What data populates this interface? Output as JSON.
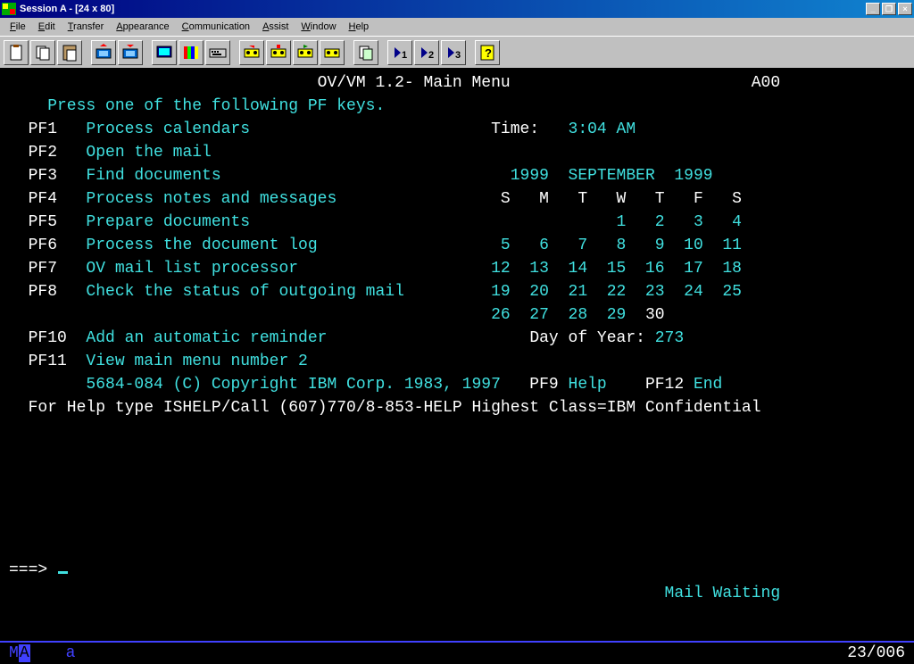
{
  "window": {
    "title": "Session A - [24 x 80]",
    "buttons": {
      "min": "_",
      "max": "❐",
      "close": "×"
    }
  },
  "menu": [
    "File",
    "Edit",
    "Transfer",
    "Appearance",
    "Communication",
    "Assist",
    "Window",
    "Help"
  ],
  "toolbar_icons": [
    "clipboard-icon",
    "copy-icon",
    "paste-icon",
    "sep",
    "send-icon",
    "receive-icon",
    "sep",
    "display-icon",
    "color-icon",
    "keyboard-icon",
    "sep",
    "record-icon",
    "stop-icon",
    "play-icon",
    "tape-icon",
    "sep",
    "remap-icon",
    "sep",
    "macro1-icon",
    "macro2-icon",
    "macro3-icon",
    "sep",
    "help-icon"
  ],
  "screen": {
    "title": "OV/VM 1.2- Main Menu",
    "code": "A00",
    "prompt": "Press one of the following PF keys.",
    "pf": [
      {
        "key": "PF1",
        "label": "Process calendars"
      },
      {
        "key": "PF2",
        "label": "Open the mail"
      },
      {
        "key": "PF3",
        "label": "Find documents"
      },
      {
        "key": "PF4",
        "label": "Process notes and messages"
      },
      {
        "key": "PF5",
        "label": "Prepare documents"
      },
      {
        "key": "PF6",
        "label": "Process the document log"
      },
      {
        "key": "PF7",
        "label": "OV mail list processor"
      },
      {
        "key": "PF8",
        "label": "Check the status of outgoing mail"
      },
      {
        "key": "PF10",
        "label": "Add an automatic reminder"
      },
      {
        "key": "PF11",
        "label": "View main menu number 2"
      }
    ],
    "time_label": "Time:",
    "time": "3:04 AM",
    "cal": {
      "year_l": "1999",
      "month": "SEPTEMBER",
      "year_r": "1999",
      "days": [
        "S",
        "M",
        "T",
        "W",
        "T",
        "F",
        "S"
      ],
      "rows": [
        [
          " ",
          " ",
          " ",
          " 1",
          " 2",
          " 3",
          " 4"
        ],
        [
          " 5",
          " 6",
          " 7",
          " 8",
          " 9",
          "10",
          "11"
        ],
        [
          "12",
          "13",
          "14",
          "15",
          "16",
          "17",
          "18"
        ],
        [
          "19",
          "20",
          "21",
          "22",
          "23",
          "24",
          "25"
        ],
        [
          "26",
          "27",
          "28",
          "29",
          "30",
          " ",
          " "
        ]
      ],
      "today": "30",
      "doy_label": "Day of Year:",
      "doy": "273"
    },
    "copyright": "5684-084 (C) Copyright IBM Corp. 1983, 1997",
    "pf9_k": "PF9",
    "pf9_l": "Help",
    "pf12_k": "PF12",
    "pf12_l": "End",
    "help_line": "For Help type ISHELP/Call (607)770/8-853-HELP Highest Class=IBM Confidential",
    "cmd_arrow": "===>",
    "mail_waiting": "Mail Waiting"
  },
  "status": {
    "m": "M",
    "a_ind": "A",
    "sess": "a",
    "pos": "23/006"
  }
}
